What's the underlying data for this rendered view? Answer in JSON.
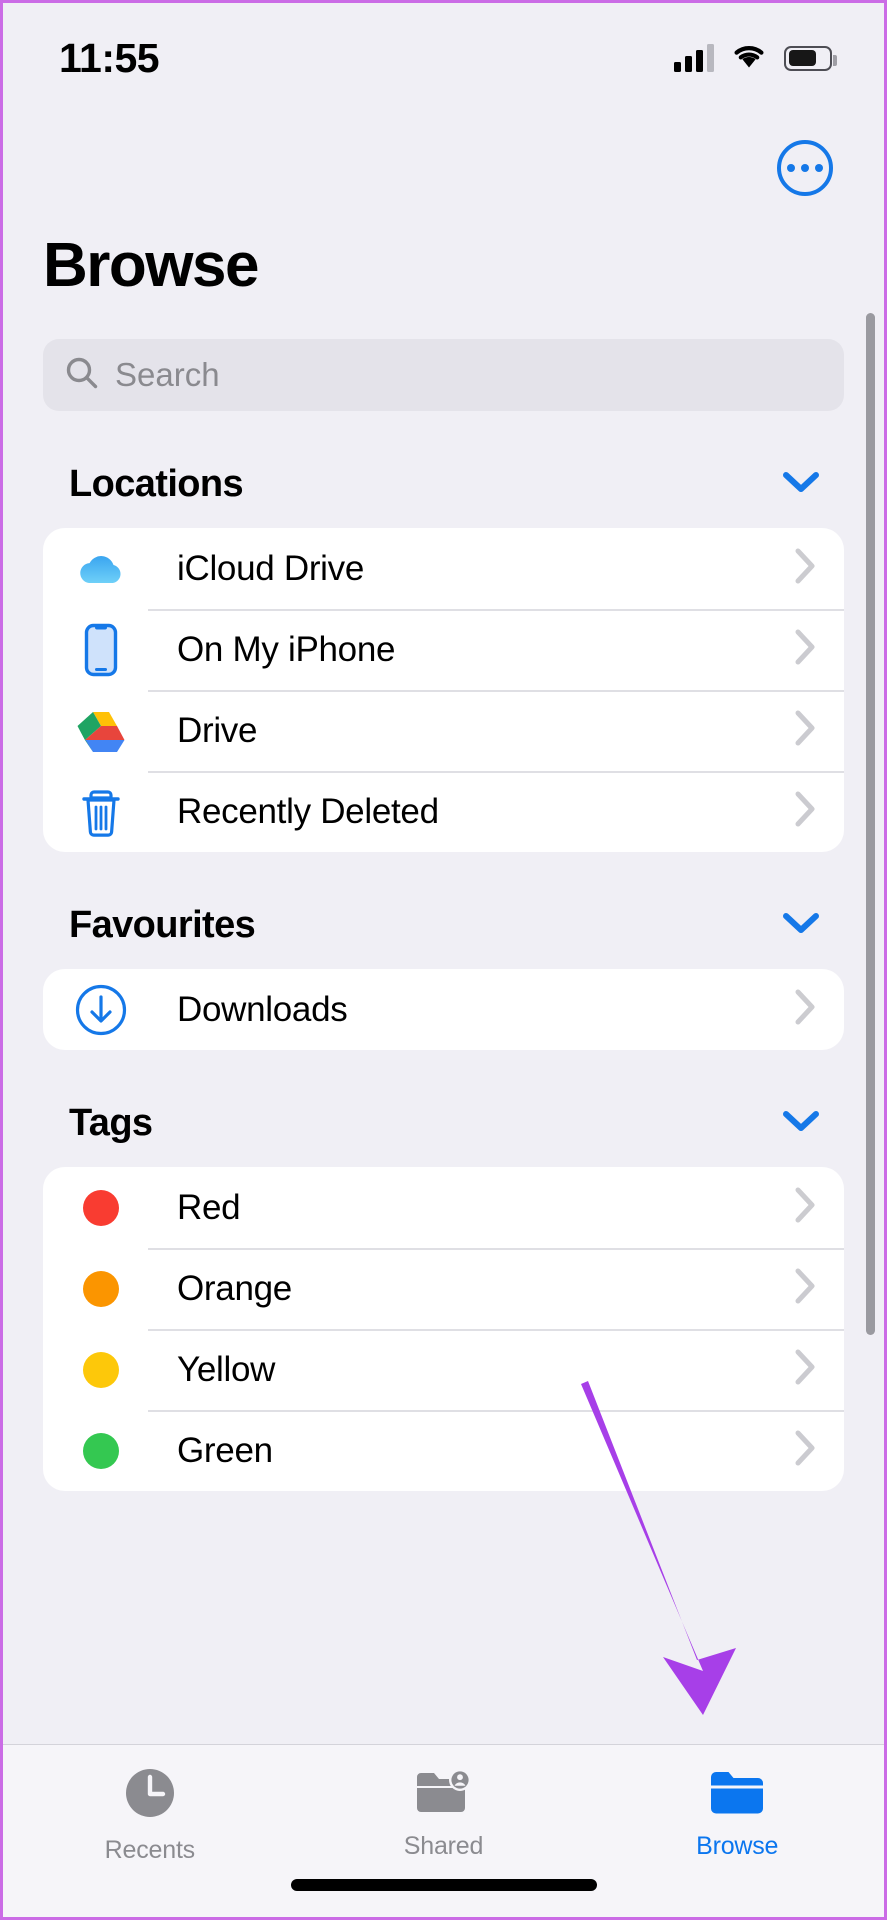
{
  "status_bar": {
    "time": "11:55",
    "cellular_icon": "cellular-signal-icon",
    "wifi_icon": "wifi-icon",
    "battery_icon": "battery-icon"
  },
  "nav": {
    "more_button": "more-options-button",
    "more_icon": "ellipsis-circle-icon"
  },
  "header": {
    "title": "Browse"
  },
  "search": {
    "placeholder": "Search",
    "icon": "search-icon"
  },
  "sections": [
    {
      "title": "Locations",
      "collapse_icon": "chevron-down-icon",
      "items": [
        {
          "label": "iCloud Drive",
          "icon": "icloud-drive-icon",
          "disclosure": "chevron-right-icon"
        },
        {
          "label": "On My iPhone",
          "icon": "iphone-icon",
          "disclosure": "chevron-right-icon"
        },
        {
          "label": "Drive",
          "icon": "google-drive-icon",
          "disclosure": "chevron-right-icon"
        },
        {
          "label": "Recently Deleted",
          "icon": "trash-icon",
          "disclosure": "chevron-right-icon"
        }
      ]
    },
    {
      "title": "Favourites",
      "collapse_icon": "chevron-down-icon",
      "items": [
        {
          "label": "Downloads",
          "icon": "download-circle-icon",
          "disclosure": "chevron-right-icon"
        }
      ]
    },
    {
      "title": "Tags",
      "collapse_icon": "chevron-down-icon",
      "items": [
        {
          "label": "Red",
          "icon": "tag-dot-icon",
          "color": "#f93c31",
          "disclosure": "chevron-right-icon"
        },
        {
          "label": "Orange",
          "icon": "tag-dot-icon",
          "color": "#fb9500",
          "disclosure": "chevron-right-icon"
        },
        {
          "label": "Yellow",
          "icon": "tag-dot-icon",
          "color": "#fdc80a",
          "disclosure": "chevron-right-icon"
        },
        {
          "label": "Green",
          "icon": "tag-dot-icon",
          "color": "#34c851",
          "disclosure": "chevron-right-icon"
        }
      ]
    }
  ],
  "annotation": {
    "type": "arrow",
    "color": "#a73fe8",
    "points_to": "browse-tab"
  },
  "tab_bar": {
    "tabs": [
      {
        "label": "Recents",
        "icon": "clock-icon",
        "active": false
      },
      {
        "label": "Shared",
        "icon": "folder-person-icon",
        "active": false
      },
      {
        "label": "Browse",
        "icon": "folder-icon",
        "active": true
      }
    ],
    "active_color": "#0b76ef",
    "inactive_color": "#8b8b90"
  },
  "colors": {
    "background": "#f0eff5",
    "card": "#ffffff",
    "accent_blue": "#0b76ef",
    "screenshot_border": "#cb6ce6"
  }
}
